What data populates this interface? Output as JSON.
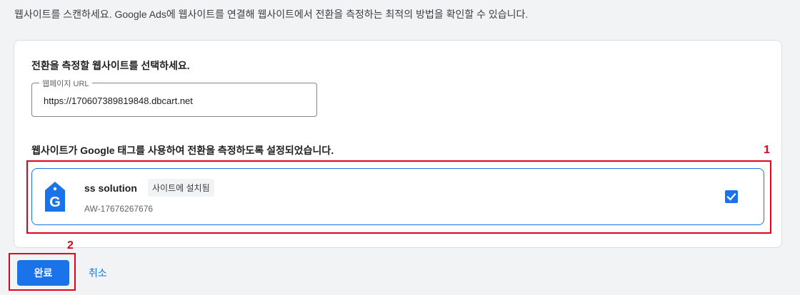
{
  "intro_text": "웹사이트를 스캔하세요. Google Ads에 웹사이트를 연결해 웹사이트에서 전환을 측정하는 최적의 방법을 확인할 수 있습니다.",
  "select_section": {
    "title": "전환을 측정할 웹사이트를 선택하세요.",
    "url_label": "웹페이지 URL",
    "url_value": "https://170607389819848.dbcart.net"
  },
  "tag_section": {
    "title": "웹사이트가 Google 태그를 사용하여 전환을 측정하도록 설정되었습니다.",
    "tag": {
      "name": "ss solution",
      "badge": "사이트에 설치됨",
      "id": "AW-17676267676",
      "checked": true,
      "icon": "google-tag-icon"
    }
  },
  "annotations": {
    "marker_1": "1",
    "marker_2": "2"
  },
  "actions": {
    "done_label": "완료",
    "cancel_label": "취소"
  },
  "colors": {
    "accent": "#1a73e8",
    "highlight": "#e2001a"
  }
}
